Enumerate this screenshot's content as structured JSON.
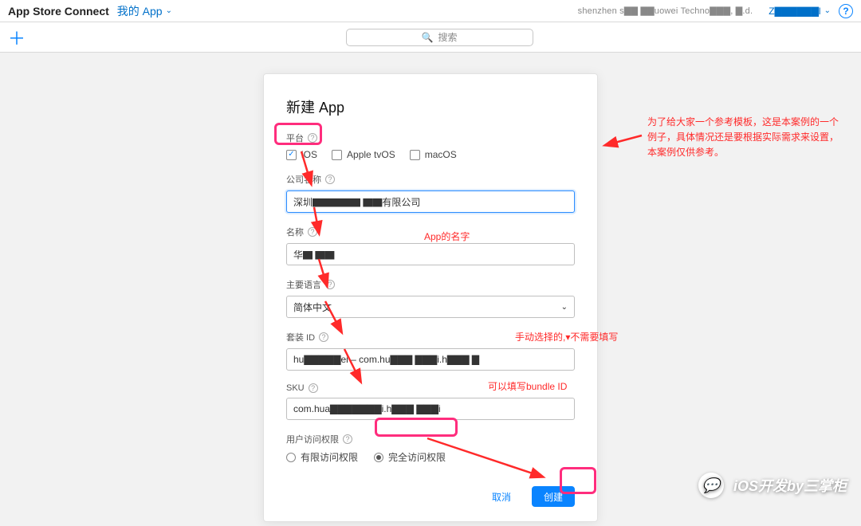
{
  "header": {
    "brand": "App Store Connect",
    "my_apps": "我的 App",
    "account": "shenzhen s▇▇  ▇▇uowei Techno▇▇▇, ▇.d.",
    "language": "Z▇▇▇▇▇▇l",
    "help_glyph": "?"
  },
  "toolbar": {
    "plus_glyph": "＋",
    "search_placeholder": "搜索",
    "search_icon": "🔍"
  },
  "modal": {
    "title": "新建 App",
    "platform": {
      "label": "平台",
      "ios": "iOS",
      "tvos": "Apple tvOS",
      "macos": "macOS",
      "ios_checked": true,
      "tvos_checked": false,
      "macos_checked": false
    },
    "company": {
      "label": "公司名称",
      "value": "深圳▇▇▇▇▇ ▇▇有限公司"
    },
    "name": {
      "label": "名称",
      "value": "华▇ ▇▇"
    },
    "lang": {
      "label": "主要语言",
      "value": "简体中文"
    },
    "bundle": {
      "label": "套装 ID",
      "value": "hu▇▇▇▇▇ei – com.hu▇▇▇  ▇▇▇i.h▇▇▇ ▇"
    },
    "sku": {
      "label": "SKU",
      "value": "com.hua▇▇▇▇▇▇▇i.h▇▇▇ ▇▇▇i"
    },
    "access": {
      "label": "用户访问权限",
      "opt_limited": "有限访问权限",
      "opt_full": "完全访问权限"
    },
    "cancel": "取消",
    "create": "创建"
  },
  "annotations": {
    "intro": "为了给大家一个参考模板，这是本案例的一个例子，具体情况还是要根据实际需求来设置，本案例仅供参考。",
    "app_name": "App的名字",
    "bundle_hint": "手动选择的,▾不需要填写",
    "sku_hint": "可以填写bundle ID"
  },
  "watermark": {
    "glyph": "💬",
    "text": "iOS开发by三掌柜"
  }
}
